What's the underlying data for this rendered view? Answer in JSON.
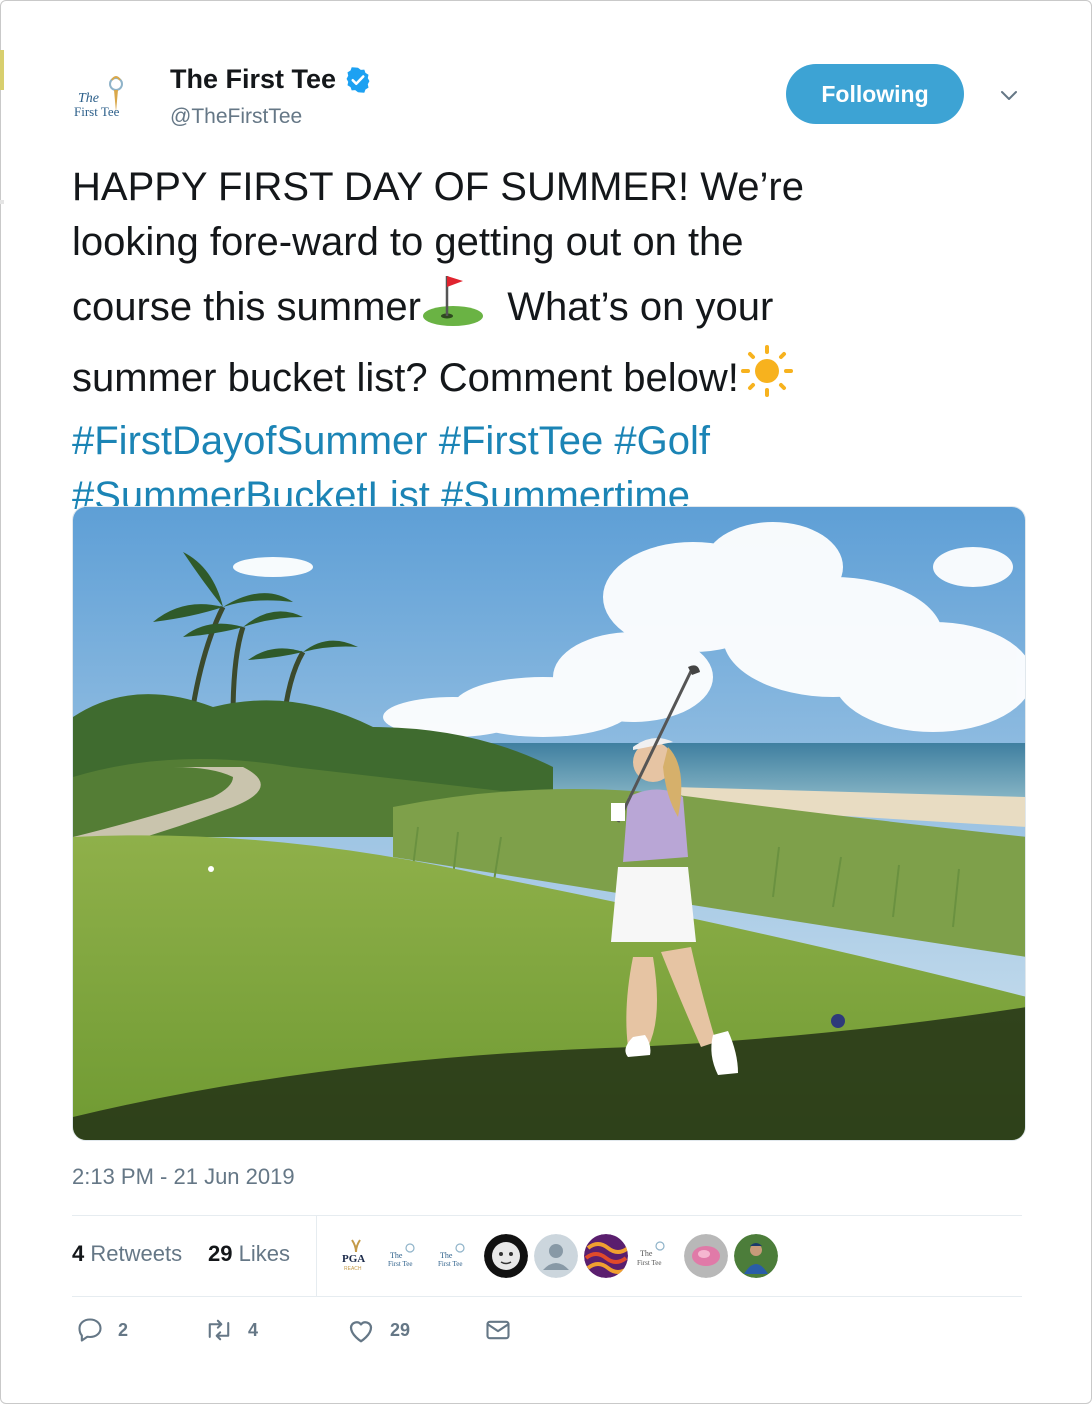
{
  "account": {
    "display_name": "The First Tee",
    "handle": "@TheFirstTee",
    "logo_text_top": "The",
    "logo_text_bottom": "First Tee",
    "follow_label": "Following"
  },
  "tweet": {
    "line1": "HAPPY FIRST DAY OF SUMMER! We’re",
    "line2": "looking fore-ward to getting out on the",
    "line3a": "course this summer",
    "line3b": "What’s on your",
    "line4": "summer bucket list? Comment below!",
    "hashtags_line1": [
      "#FirstDayofSummer",
      "#FirstTee",
      "#Golf"
    ],
    "hashtags_line2": [
      "#SummerBucketList",
      "#Summertime"
    ],
    "timestamp": "2:13 PM - 21 Jun 2019"
  },
  "stats": {
    "retweets_count": "4",
    "retweets_label": "Retweets",
    "likes_count": "29",
    "likes_label": "Likes"
  },
  "likers": [
    {
      "icon": "pga-reach-logo"
    },
    {
      "icon": "first-tee-logo"
    },
    {
      "icon": "first-tee-logo"
    },
    {
      "icon": "baby-avatar"
    },
    {
      "icon": "default-avatar"
    },
    {
      "icon": "pattern-avatar"
    },
    {
      "icon": "first-tee-san-diego-logo"
    },
    {
      "icon": "pink-flower-avatar"
    },
    {
      "icon": "golfer-avatar"
    }
  ],
  "liker_labels": {
    "pga": "PGA",
    "reach": "REACH"
  },
  "actions": {
    "reply_count": "2",
    "retweet_count": "4",
    "like_count": "29"
  },
  "colors": {
    "accent": "#1b84b5",
    "follow_button": "#3da3d4",
    "muted": "#657786"
  }
}
